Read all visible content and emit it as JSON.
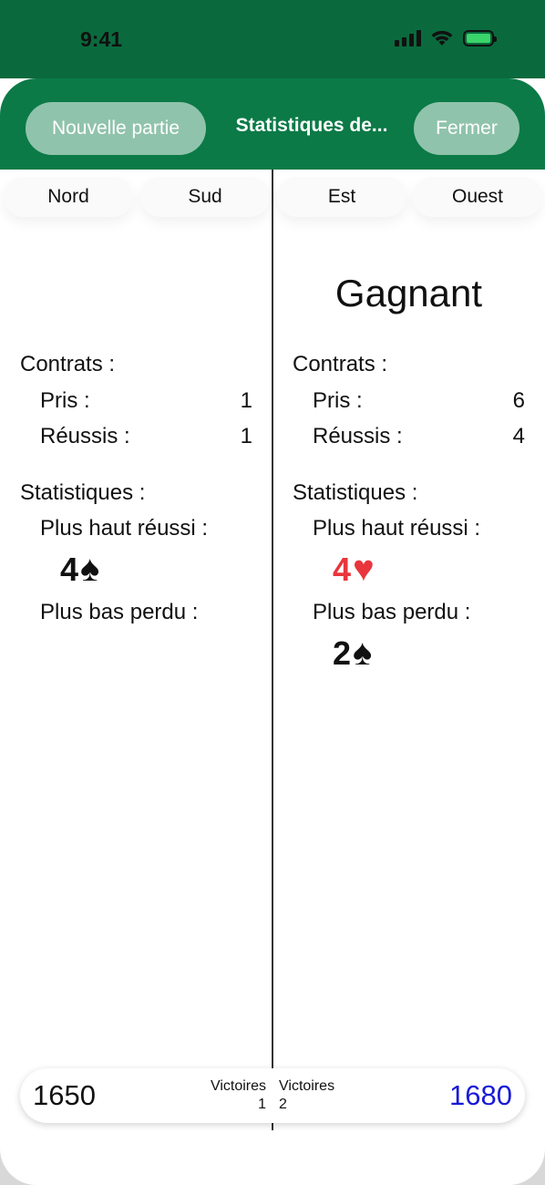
{
  "status": {
    "time": "9:41"
  },
  "nav": {
    "new_game": "Nouvelle partie",
    "title": "Statistiques de...",
    "close": "Fermer"
  },
  "tabs": [
    "Nord",
    "Sud",
    "Est",
    "Ouest"
  ],
  "left": {
    "winner": "",
    "contracts_label": "Contrats :",
    "taken_label": "Pris :",
    "taken": "1",
    "succeeded_label": "Réussis :",
    "succeeded": "1",
    "stats_label": "Statistiques :",
    "highest_label": "Plus haut réussi :",
    "highest_level": "4",
    "highest_suit": "♠",
    "lowest_label": "Plus bas perdu :"
  },
  "right": {
    "winner": "Gagnant",
    "contracts_label": "Contrats :",
    "taken_label": "Pris :",
    "taken": "6",
    "succeeded_label": "Réussis :",
    "succeeded": "4",
    "stats_label": "Statistiques :",
    "highest_label": "Plus haut réussi :",
    "highest_level": "4",
    "highest_suit": "♥",
    "lowest_label": "Plus bas perdu :",
    "lowest_level": "2",
    "lowest_suit": "♠"
  },
  "score": {
    "left_score": "1650",
    "left_wins_label": "Victoires",
    "left_wins": "1",
    "right_wins_label": "Victoires",
    "right_wins": "2",
    "right_score": "1680"
  },
  "colors": {
    "header_green": "#0b7a47",
    "heart_red": "#e8363c",
    "score_blue": "#1a1ad6"
  }
}
